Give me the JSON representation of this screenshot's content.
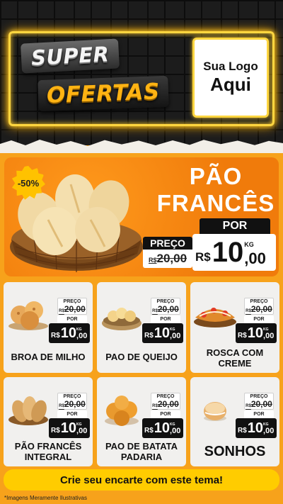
{
  "header": {
    "super": "SUPER",
    "ofertas": "OFERTAS",
    "logo_line1": "Sua Logo",
    "logo_line2": "Aqui"
  },
  "hero": {
    "discount": "-50%",
    "title_line1": "PÃO",
    "title_line2": "FRANCÊS",
    "por_label": "POR",
    "preco_label": "PREÇO",
    "old_currency": "R$",
    "old_price": "20,00",
    "currency": "R$",
    "price_int": "10",
    "price_dec": ",00",
    "unit": "KG"
  },
  "products": [
    {
      "name": "BROA DE MILHO",
      "preco_label": "PREÇO",
      "old_currency": "R$",
      "old_price": "20,00",
      "por_label": "POR",
      "currency": "R$",
      "price_int": "10",
      "price_dec": ",00",
      "unit": "KG"
    },
    {
      "name": "PAO DE QUEIJO",
      "preco_label": "PREÇO",
      "old_currency": "R$",
      "old_price": "20,00",
      "por_label": "POR",
      "currency": "R$",
      "price_int": "10",
      "price_dec": ",00",
      "unit": "KG"
    },
    {
      "name": "ROSCA COM CREME",
      "preco_label": "PREÇO",
      "old_currency": "R$",
      "old_price": "20,00",
      "por_label": "POR",
      "currency": "R$",
      "price_int": "10",
      "price_dec": ",00",
      "unit": "KG"
    },
    {
      "name": "PÃO FRANCÊS INTEGRAL",
      "preco_label": "PREÇO",
      "old_currency": "R$",
      "old_price": "20,00",
      "por_label": "POR",
      "currency": "R$",
      "price_int": "10",
      "price_dec": ",00",
      "unit": "KG"
    },
    {
      "name": "PAO DE BATATA PADARIA",
      "preco_label": "PREÇO",
      "old_currency": "R$",
      "old_price": "20,00",
      "por_label": "POR",
      "currency": "R$",
      "price_int": "10",
      "price_dec": ",00",
      "unit": "KG"
    },
    {
      "name": "SONHOS",
      "preco_label": "PREÇO",
      "old_currency": "R$",
      "old_price": "20,00",
      "por_label": "POR",
      "currency": "R$",
      "price_int": "10",
      "price_dec": ",00",
      "unit": "KG"
    }
  ],
  "footer": {
    "cta": "Crie seu encarte com este tema!",
    "disclaimer": "*Imagens Meramente Ilustrativas"
  },
  "colors": {
    "background": "#f7a21b",
    "neon": "#ffd640",
    "hero": "#f07b0b",
    "cta_bar": "#ffcc00"
  }
}
